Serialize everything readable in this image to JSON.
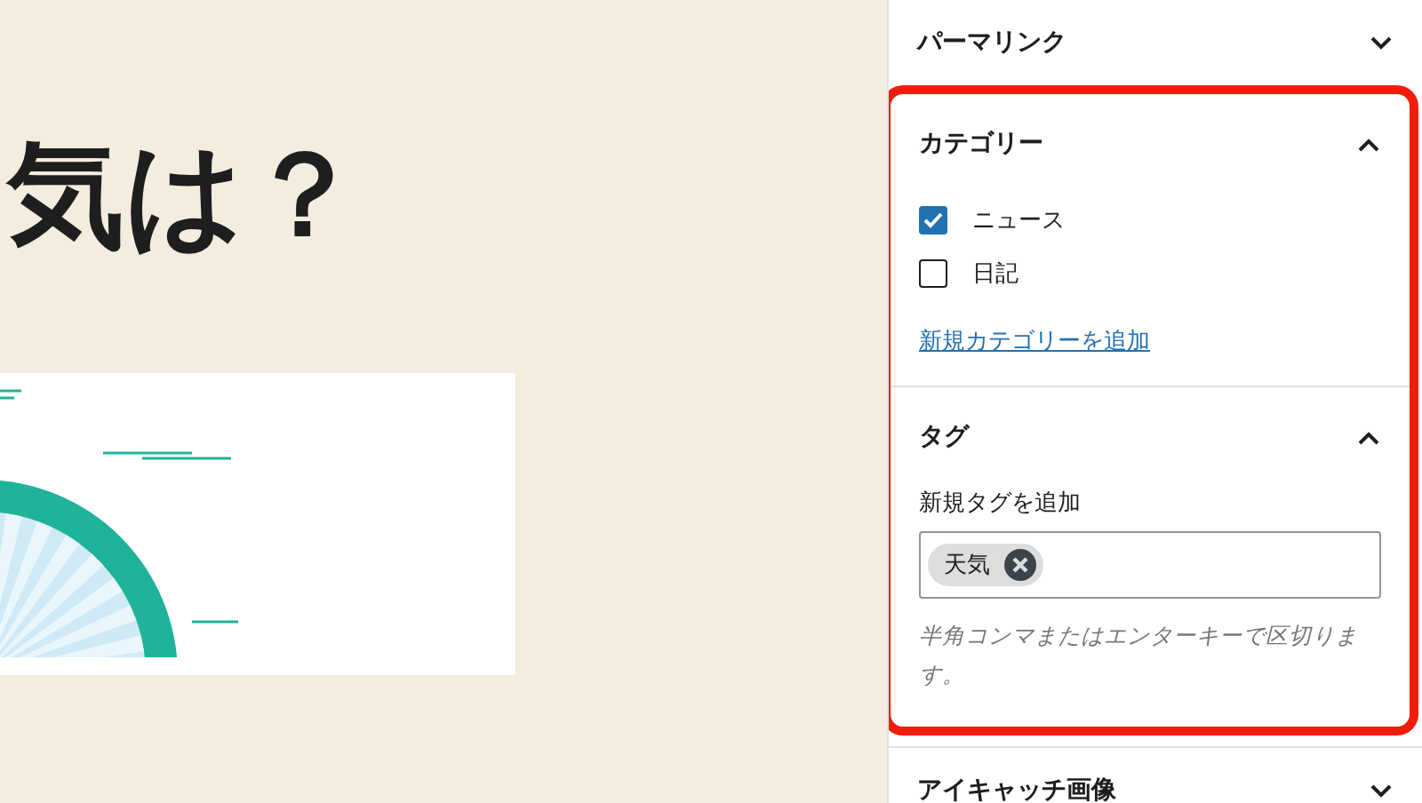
{
  "editor": {
    "title": "気は？"
  },
  "sidebar": {
    "panels": [
      {
        "kind": "collapsed",
        "title": "パーマリンク",
        "expanded": false,
        "highlighted": false
      },
      {
        "kind": "categories",
        "title": "カテゴリー",
        "expanded": true,
        "highlighted": true,
        "categories": [
          {
            "label": "ニュース",
            "checked": true
          },
          {
            "label": "日記",
            "checked": false
          }
        ],
        "add_link": "新規カテゴリーを追加"
      },
      {
        "kind": "tags",
        "title": "タグ",
        "expanded": true,
        "highlighted": true,
        "field_label": "新規タグを追加",
        "tags": [
          "天気"
        ],
        "help": "半角コンマまたはエンターキーで区切ります。"
      },
      {
        "kind": "collapsed",
        "title": "アイキャッチ画像",
        "expanded": false,
        "highlighted": false
      }
    ]
  }
}
